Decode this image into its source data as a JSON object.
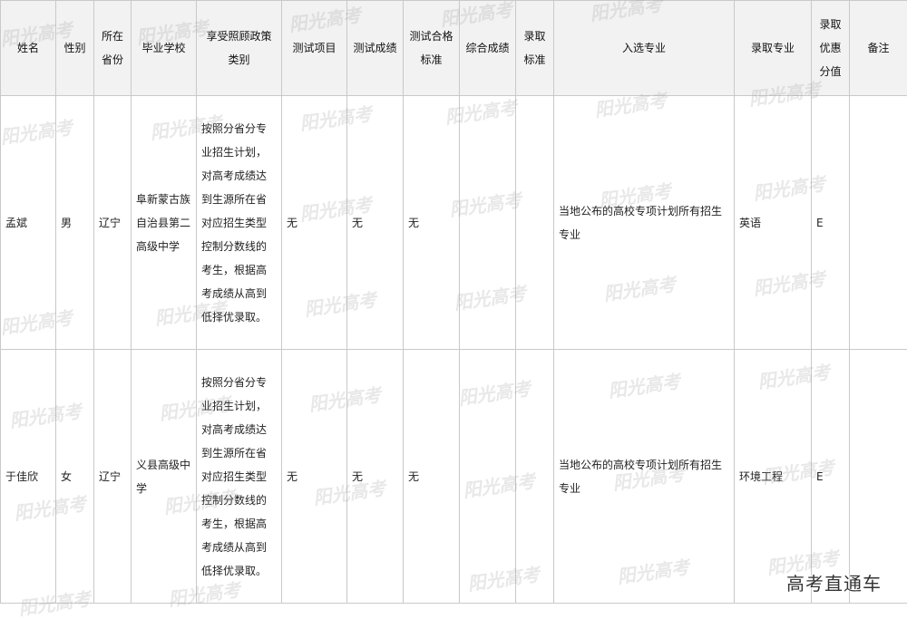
{
  "headers": [
    "姓名",
    "性别",
    "所在省份",
    "毕业学校",
    "享受照顾政策类别",
    "测试项目",
    "测试成绩",
    "测试合格标准",
    "综合成绩",
    "录取标准",
    "入选专业",
    "录取专业",
    "录取优惠分值",
    "备注"
  ],
  "rows": [
    [
      "孟斌",
      "男",
      "辽宁",
      "阜新蒙古族自治县第二高级中学",
      "按照分省分专业招生计划，对高考成绩达到生源所在省对应招生类型控制分数线的考生，根据高考成绩从高到低择优录取。",
      "无",
      "无",
      "无",
      "",
      "",
      "当地公布的高校专项计划所有招生专业",
      "英语",
      "E",
      ""
    ],
    [
      "于佳欣",
      "女",
      "辽宁",
      "义县高级中学",
      "按照分省分专业招生计划，对高考成绩达到生源所在省对应招生类型控制分数线的考生，根据高考成绩从高到低择优录取。",
      "无",
      "无",
      "无",
      "",
      "",
      "当地公布的高校专项计划所有招生专业",
      "环境工程",
      "E",
      ""
    ]
  ],
  "watermark": "阳光高考",
  "corner_logo": "高考直通车"
}
